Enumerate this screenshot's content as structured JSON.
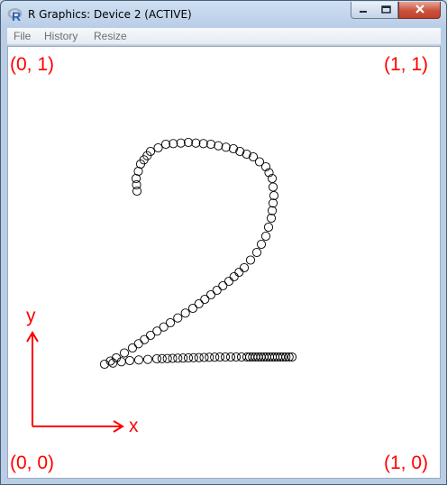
{
  "window": {
    "title": "R Graphics: Device 2 (ACTIVE)",
    "app_icon": "r-logo-icon",
    "controls": [
      "minimize-icon",
      "maximize-icon",
      "close-icon"
    ]
  },
  "menu": {
    "items": [
      {
        "label": "File"
      },
      {
        "label": "History"
      },
      {
        "label": "Resize"
      }
    ]
  },
  "plot": {
    "corner_labels": {
      "top_left": "(0, 1)",
      "top_right": "(1, 1)",
      "bottom_left": "(0, 0)",
      "bottom_right": "(1, 0)"
    },
    "axis_labels": {
      "x": "x",
      "y": "y"
    },
    "axis_color": "#ff0000",
    "marker_color": "#000000",
    "marker": "open-circle",
    "digit_drawn": "2"
  }
}
